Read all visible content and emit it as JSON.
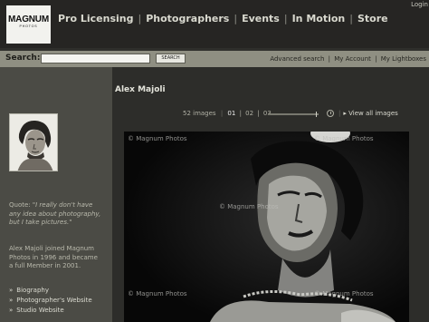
{
  "header": {
    "logo": {
      "wordmark": "MAGNUM",
      "sub": "PHOTOS"
    },
    "nav": [
      "Pro Licensing",
      "Photographers",
      "Events",
      "In Motion",
      "Store"
    ],
    "nav_separator": "|",
    "login": "Login"
  },
  "search": {
    "label": "Search:",
    "value": "",
    "button": "SEARCH",
    "links": [
      "Advanced search",
      "My Account",
      "My Lightboxes"
    ],
    "link_separator": "|"
  },
  "sidebar": {
    "quote_prefix": "Quote: ",
    "quote_text": "\"I really don't have any idea about photography, but I take pictures.\"",
    "bio": "Alex Majoli joined Magnum Photos in 1996 and became a full Member in 2001.",
    "links": [
      "Biography",
      "Photographer's Website",
      "Studio Website"
    ]
  },
  "main": {
    "title": "Alex Majoli",
    "pager": {
      "count_label": "52 images",
      "pages": [
        "01",
        "02",
        "03"
      ],
      "current_page": "01",
      "separator": "|",
      "view_all": "View all images"
    },
    "photo": {
      "watermarks": [
        "© Magnum Photos",
        "© Magnum Photos",
        "© Magnum Photos",
        "© Magnum Photos",
        "© Magnum Photos"
      ]
    }
  },
  "colors": {
    "header_bg": "#262523",
    "searchbar_bg": "#8f8f82",
    "sidebar_bg": "#4b4b45",
    "main_bg": "#2d2d2a"
  }
}
